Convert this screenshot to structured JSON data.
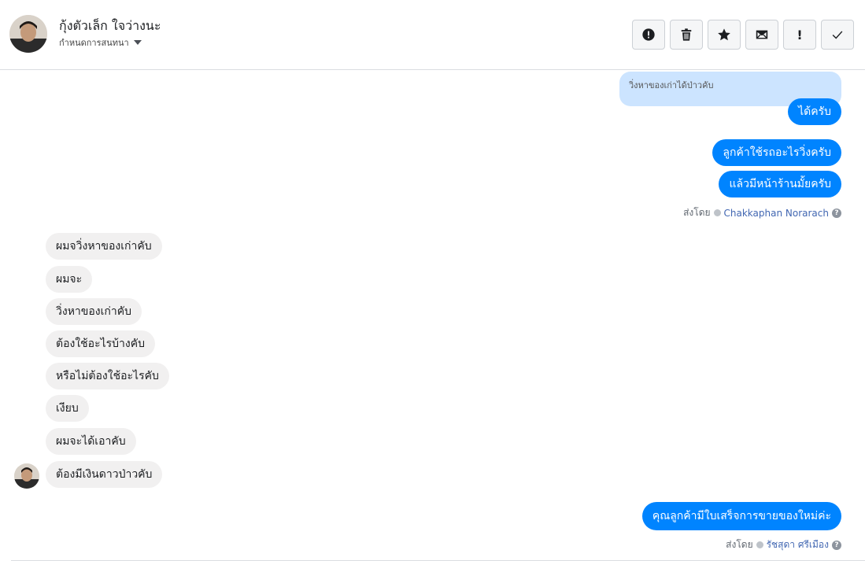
{
  "header": {
    "contact_name": "กุ้งตัวเล็ก ใจว่างนะ",
    "assign_label": "กำหนดการสนทนา",
    "avatar_icon": "person-avatar-icon"
  },
  "actions": [
    {
      "name": "spam-button",
      "icon": "alert-circle-icon"
    },
    {
      "name": "delete-button",
      "icon": "trash-icon"
    },
    {
      "name": "star-button",
      "icon": "star-icon"
    },
    {
      "name": "mark-unread-button",
      "icon": "envelope-icon"
    },
    {
      "name": "follow-up-button",
      "icon": "exclamation-icon",
      "text": "!"
    },
    {
      "name": "done-button",
      "icon": "checkmark-icon"
    }
  ],
  "thread": {
    "reply_quote": "วิ่งหาของเก่าได้ป่าวคับ",
    "outgoing_1": [
      "ได้ครับ",
      "ลูกค้าใช้รถอะไรวิ่งครับ",
      "แล้วมีหน้าร้านมั้ยครับ"
    ],
    "sent_by_label": "ส่งโดย",
    "agent_1": "Chakkaphan Norarach",
    "incoming": [
      "ผมจวิ่งหาของเก่าคับ",
      "ผมจะ",
      "วิ่งหาของเก่าคับ",
      "ต้องใช้อะไรบ้างคับ",
      "หรือไม่ต้องใช้อะไรคับ",
      "เงียบ",
      "ผมจะได้เอาคับ",
      "ต้องมีเงินดาวป่าวคับ"
    ],
    "outgoing_2": "คุณลูกค้ามีใบเสร็จการขายของใหม่ค่ะ",
    "agent_2": "รัชสุดา ศรีเมือง",
    "help_glyph": "?"
  },
  "colors": {
    "outgoing_bubble": "#0084ff",
    "incoming_bubble": "#f1f0f0",
    "quote_bubble": "#cce4ff",
    "agent_link": "#4267b2"
  }
}
